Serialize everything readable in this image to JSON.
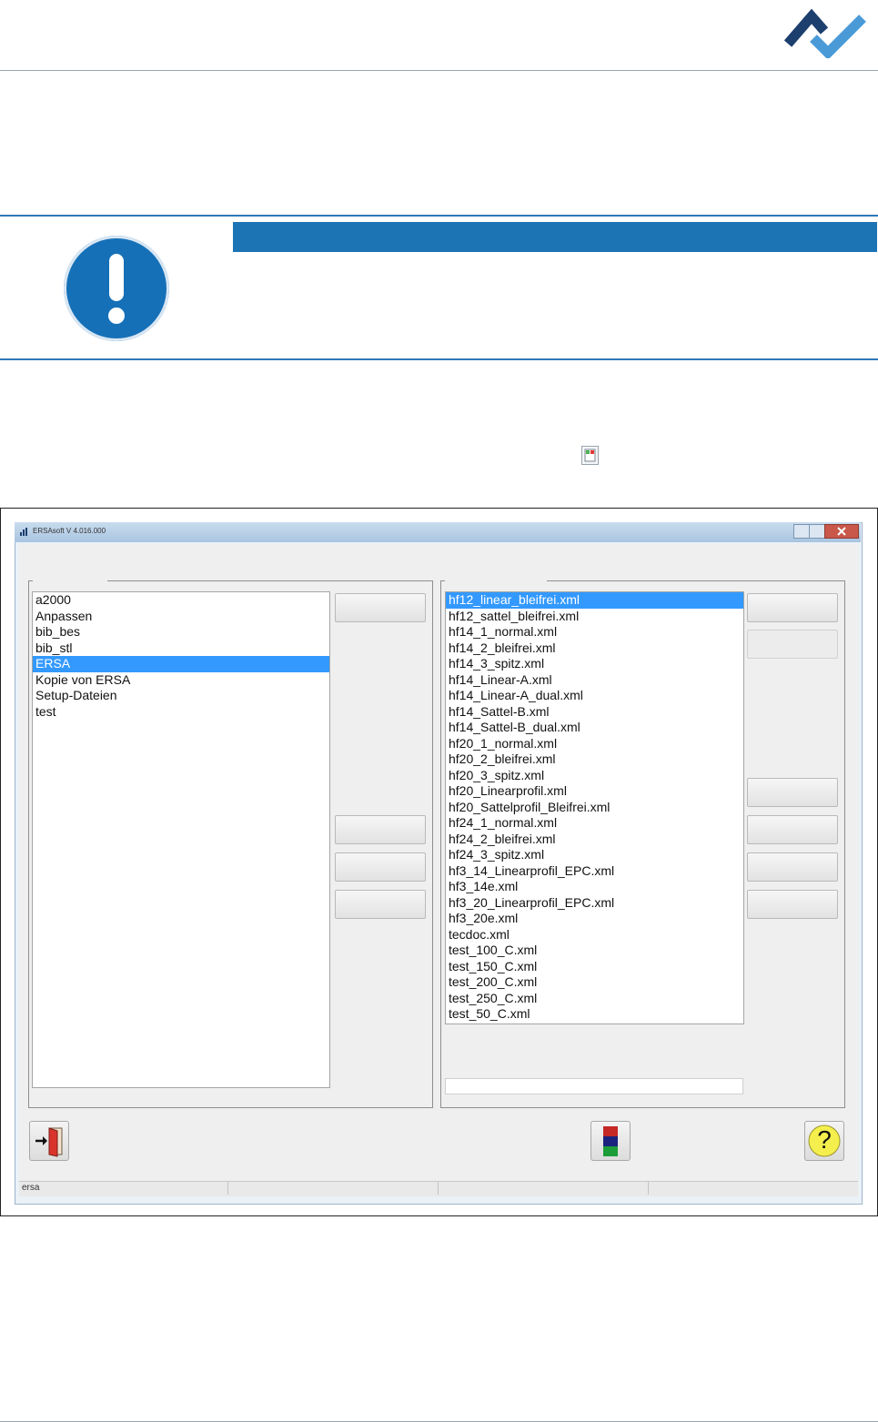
{
  "window": {
    "title": "ERSAsoft V 4.016.000"
  },
  "left_list": {
    "items": [
      "a2000",
      "Anpassen",
      "bib_bes",
      "bib_stl",
      "ERSA",
      "Kopie von ERSA",
      "Setup-Dateien",
      "test"
    ],
    "selected_index": 4
  },
  "right_list": {
    "items": [
      "hf12_linear_bleifrei.xml",
      "hf12_sattel_bleifrei.xml",
      "hf14_1_normal.xml",
      "hf14_2_bleifrei.xml",
      "hf14_3_spitz.xml",
      "hf14_Linear-A.xml",
      "hf14_Linear-A_dual.xml",
      "hf14_Sattel-B.xml",
      "hf14_Sattel-B_dual.xml",
      "hf20_1_normal.xml",
      "hf20_2_bleifrei.xml",
      "hf20_3_spitz.xml",
      "hf20_Linearprofil.xml",
      "hf20_Sattelprofil_Bleifrei.xml",
      "hf24_1_normal.xml",
      "hf24_2_bleifrei.xml",
      "hf24_3_spitz.xml",
      "hf3_14_Linearprofil_EPC.xml",
      "hf3_14e.xml",
      "hf3_20_Linearprofil_EPC.xml",
      "hf3_20e.xml",
      "tecdoc.xml",
      "test_100_C.xml",
      "test_150_C.xml",
      "test_200_C.xml",
      "test_250_C.xml",
      "test_50_C.xml"
    ],
    "selected_index": 0
  },
  "help_button": {
    "label": "?"
  },
  "statusbar": {
    "text": "ersa"
  },
  "colors": {
    "brand_dark": "#1c3f6e",
    "brand_light": "#4a9ad8",
    "notice_blue": "#1d74b4",
    "selection": "#3399ff"
  }
}
